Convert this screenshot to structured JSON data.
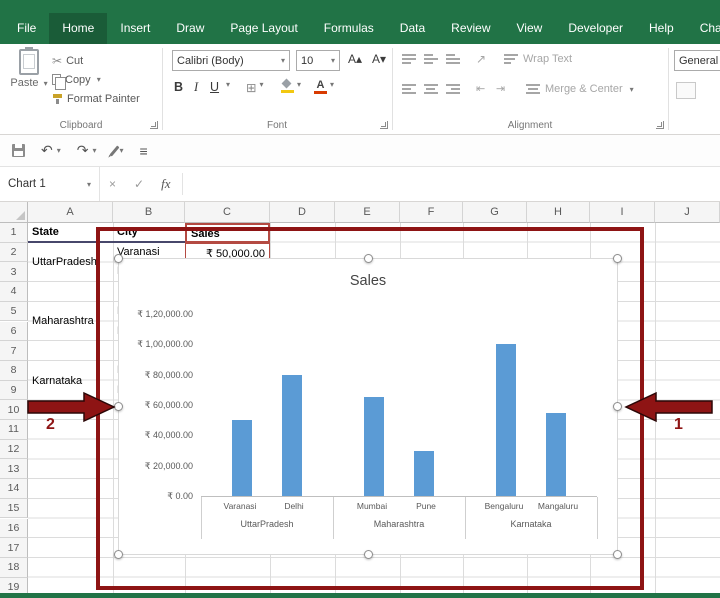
{
  "colors": {
    "ribbon_green": "#217346",
    "ribbon_green_active": "#1a5c38",
    "annotation_red": "#8e1414",
    "bar_blue": "#5B9BD5",
    "range_highlight_red": "#b44a42",
    "header_underline": "#47476b"
  },
  "icons": {
    "dropdown": "▾",
    "cut": "✂",
    "borders": "⊞",
    "undo": "↶",
    "redo": "↷",
    "menu": "≡",
    "orientation": "↗",
    "cancel": "×",
    "enter": "✓",
    "grow": "A▴",
    "shrink": "A▾",
    "color_a": "A"
  },
  "ribbon": {
    "tabs": [
      {
        "label": "File",
        "active": false
      },
      {
        "label": "Home",
        "active": true
      },
      {
        "label": "Insert",
        "active": false
      },
      {
        "label": "Draw",
        "active": false
      },
      {
        "label": "Page Layout",
        "active": false
      },
      {
        "label": "Formulas",
        "active": false
      },
      {
        "label": "Data",
        "active": false
      },
      {
        "label": "Review",
        "active": false
      },
      {
        "label": "View",
        "active": false
      },
      {
        "label": "Developer",
        "active": false
      },
      {
        "label": "Help",
        "active": false
      },
      {
        "label": "Chart Design",
        "active": false
      }
    ],
    "clipboard": {
      "paste": "Paste",
      "cut": "Cut",
      "copy": "Copy",
      "format_painter": "Format Painter",
      "group": "Clipboard"
    },
    "font": {
      "name": "Calibri (Body)",
      "size": "10",
      "bold": "B",
      "italic": "I",
      "underline": "U",
      "group": "Font"
    },
    "alignment": {
      "wrap_text": "Wrap Text",
      "merge_center": "Merge & Center",
      "group": "Alignment"
    },
    "number": {
      "format": "General"
    }
  },
  "namebox": {
    "value": "Chart 1",
    "fx": "fx"
  },
  "sheet": {
    "columns": [
      "A",
      "B",
      "C",
      "D",
      "E",
      "F",
      "G",
      "H",
      "I",
      "J"
    ],
    "rows": [
      "1",
      "2",
      "3",
      "4",
      "5",
      "6",
      "7",
      "8",
      "9",
      "10",
      "11",
      "12",
      "13",
      "14",
      "15",
      "16",
      "17",
      "18",
      "19"
    ],
    "cells": {
      "a1": "State",
      "b1": "City",
      "c1": "Sales",
      "a2": "UttarPradesh",
      "b2": "Varanasi",
      "c2": "₹ 50,000.00",
      "b3": "Delhi",
      "a5": "Maharashtra",
      "b5": "Mumbai",
      "b6": "Pune",
      "a8": "Karnataka",
      "b8": "Bengaluru",
      "b9": "Mangaluru"
    }
  },
  "chart_data": {
    "type": "bar",
    "title": "Sales",
    "categories": [
      "Varanasi",
      "Delhi",
      "Mumbai",
      "Pune",
      "Bengaluru",
      "Mangaluru"
    ],
    "values": [
      50000,
      80000,
      65000,
      30000,
      100000,
      55000
    ],
    "groups": [
      {
        "state": "UttarPradesh",
        "points": [
          {
            "city": "Varanasi",
            "value": 50000
          },
          {
            "city": "Delhi",
            "value": 80000
          }
        ]
      },
      {
        "state": "Maharashtra",
        "points": [
          {
            "city": "Mumbai",
            "value": 65000
          },
          {
            "city": "Pune",
            "value": 30000
          }
        ]
      },
      {
        "state": "Karnataka",
        "points": [
          {
            "city": "Bengaluru",
            "value": 100000
          },
          {
            "city": "Mangaluru",
            "value": 55000
          }
        ]
      }
    ],
    "ylim": [
      0,
      120000
    ],
    "ytick_step": 20000,
    "ytick_labels": [
      "₹ 0.00",
      "₹ 20,000.00",
      "₹ 40,000.00",
      "₹ 60,000.00",
      "₹ 80,000.00",
      "₹ 1,00,000.00",
      "₹ 1,20,000.00"
    ],
    "bar_color": "#5B9BD5",
    "legend": false,
    "gridlines": false
  },
  "annotations": {
    "arrow_right_label": "1",
    "arrow_left_label": "2"
  }
}
